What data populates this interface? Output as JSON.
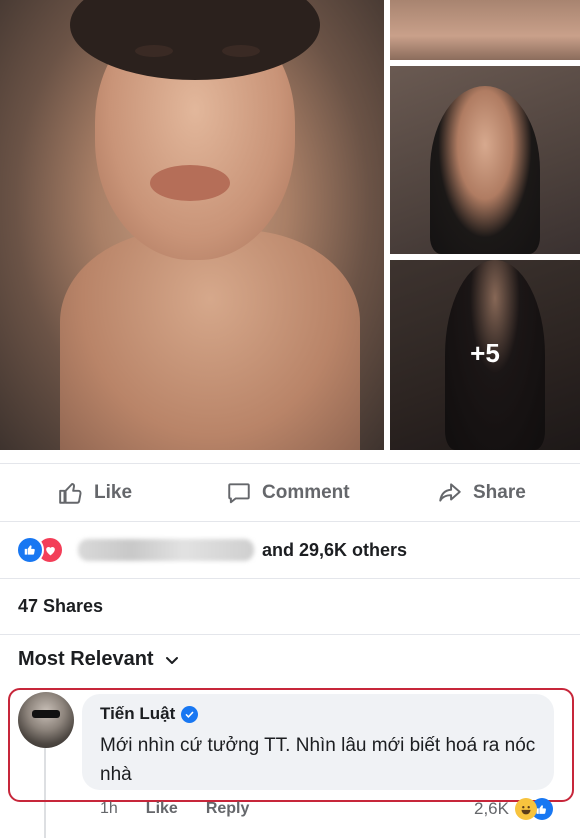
{
  "photos": {
    "more_count": "+5"
  },
  "actions": {
    "like_label": "Like",
    "comment_label": "Comment",
    "share_label": "Share"
  },
  "reactions": {
    "others_text": "and 29,6K others"
  },
  "shares_text": "47 Shares",
  "sort": {
    "label": "Most Relevant"
  },
  "comment": {
    "author": "Tiến Luật",
    "text": "Mới nhìn cứ tưởng TT. Nhìn lâu mới biết hoá ra nóc nhà",
    "time": "1h",
    "like_label": "Like",
    "reply_label": "Reply",
    "reaction_count": "2,6K"
  },
  "colors": {
    "facebook_blue": "#1877f2",
    "love_red": "#f33e58",
    "highlight_red": "#c7263a",
    "haha_yellow": "#f7c33e"
  }
}
